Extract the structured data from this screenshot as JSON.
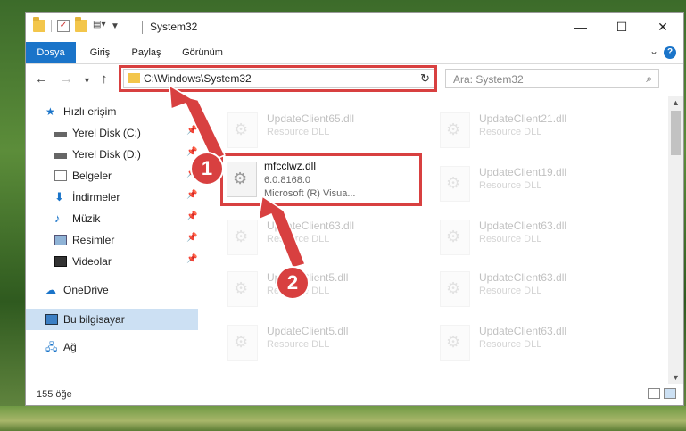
{
  "window": {
    "title": "System32"
  },
  "window_controls": {
    "minimize": "—",
    "maximize": "☐",
    "close": "✕"
  },
  "ribbon": {
    "tabs": [
      "Dosya",
      "Giriş",
      "Paylaş",
      "Görünüm"
    ],
    "help_label": "?"
  },
  "address_bar": {
    "path": "C:\\Windows\\System32",
    "refresh": "↻"
  },
  "search": {
    "placeholder": "Ara: System32"
  },
  "sidebar": {
    "items": [
      {
        "label": "Hızlı erişim",
        "icon": "star-icon",
        "pinned": false
      },
      {
        "label": "Yerel Disk (C:)",
        "icon": "drive-icon",
        "pinned": true
      },
      {
        "label": "Yerel Disk (D:)",
        "icon": "drive-icon",
        "pinned": true
      },
      {
        "label": "Belgeler",
        "icon": "documents-icon",
        "pinned": true
      },
      {
        "label": "İndirmeler",
        "icon": "downloads-icon",
        "pinned": true
      },
      {
        "label": "Müzik",
        "icon": "music-icon",
        "pinned": true
      },
      {
        "label": "Resimler",
        "icon": "pictures-icon",
        "pinned": true
      },
      {
        "label": "Videolar",
        "icon": "videos-icon",
        "pinned": true
      },
      {
        "label": "OneDrive",
        "icon": "cloud-icon",
        "pinned": false
      },
      {
        "label": "Bu bilgisayar",
        "icon": "computer-icon",
        "pinned": false,
        "selected": true
      },
      {
        "label": "Ağ",
        "icon": "network-icon",
        "pinned": false
      }
    ]
  },
  "files": {
    "left": [
      {
        "name": "UpdateClient65.dll",
        "type": "Resource DLL"
      },
      {
        "name": "UpdateClient63.dll",
        "type": "Resource DLL"
      },
      {
        "name": "UpdateClient5.dll",
        "type": "Resource DLL"
      },
      {
        "name": "UpdateClient5.dll",
        "type": "Resource DLL"
      }
    ],
    "right": [
      {
        "name": "UpdateClient21.dll",
        "type": "Resource DLL"
      },
      {
        "name": "UpdateClient19.dll",
        "type": "Resource DLL"
      },
      {
        "name": "UpdateClient63.dll",
        "type": "Resource DLL"
      },
      {
        "name": "UpdateClient63.dll",
        "type": "Resource DLL"
      },
      {
        "name": "UpdateClient63.dll",
        "type": "Resource DLL"
      }
    ],
    "highlighted": {
      "name": "mfcclwz.dll",
      "version": "6.0.8168.0",
      "description": "Microsoft (R) Visua..."
    }
  },
  "status_bar": {
    "count": "155 öğe"
  },
  "callouts": [
    "1",
    "2"
  ],
  "colors": {
    "accent": "#1a74c9",
    "highlight": "#d84040",
    "selected": "#cce0f3"
  }
}
